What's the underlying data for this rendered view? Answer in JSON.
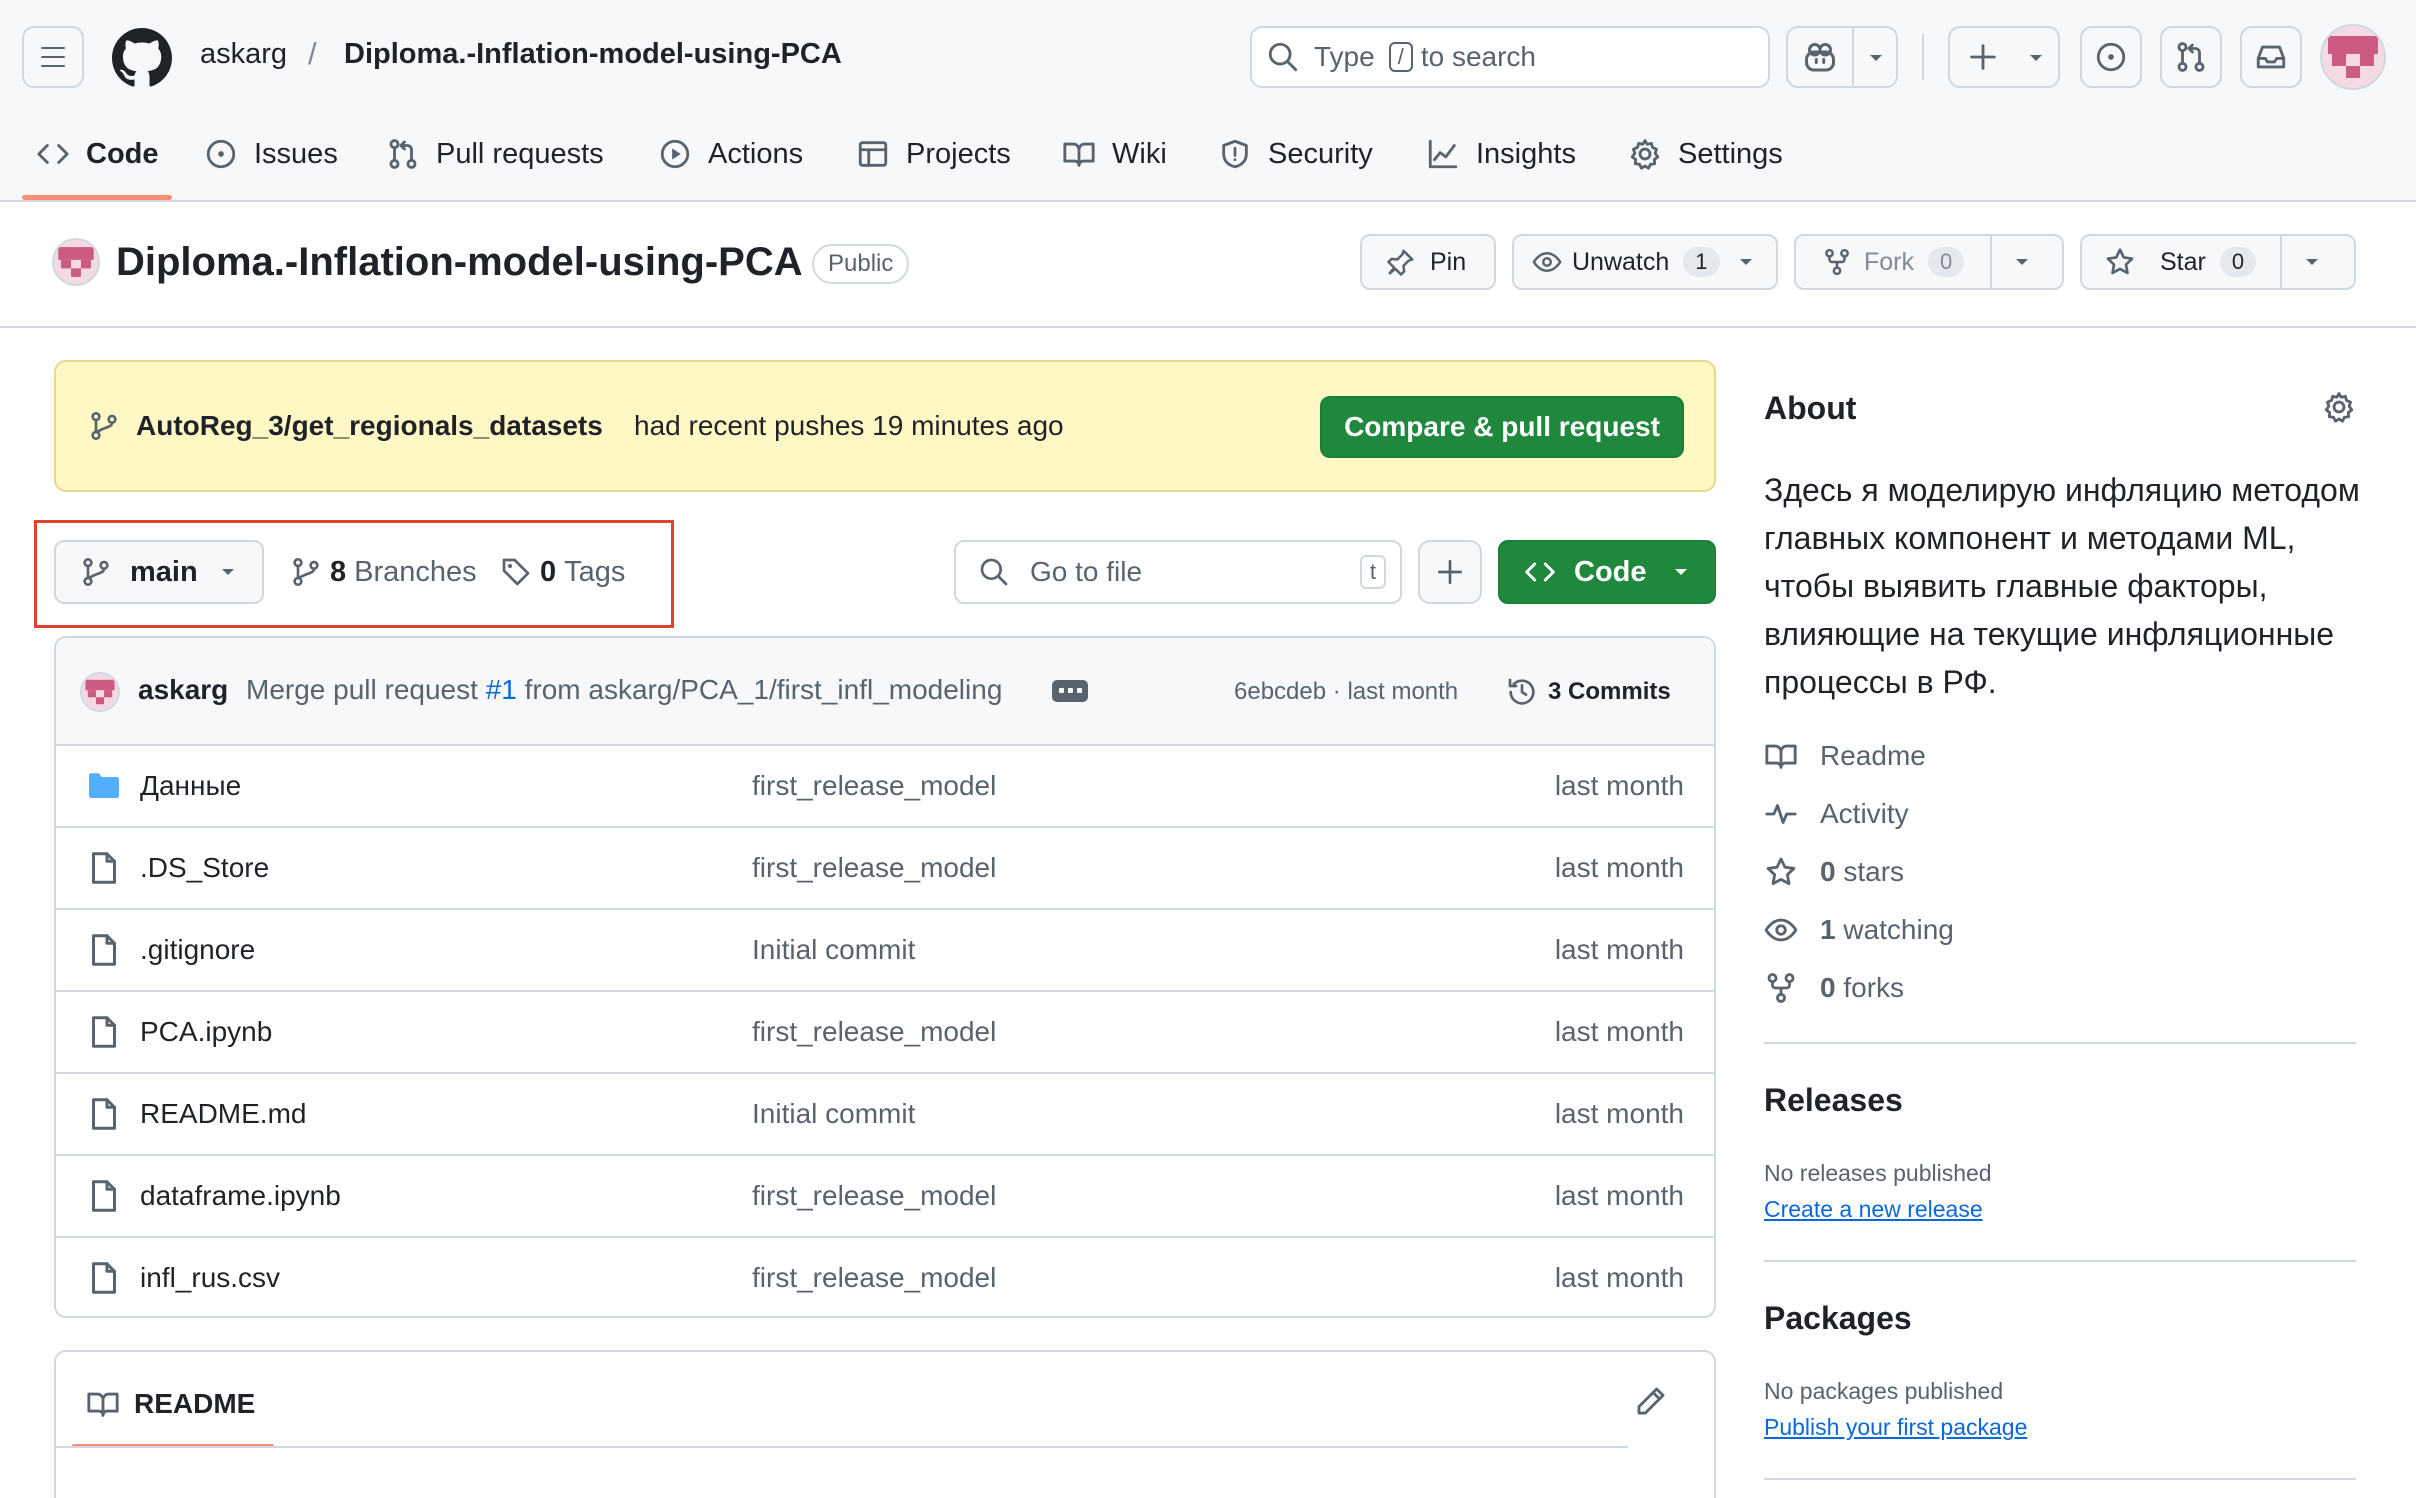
{
  "header": {
    "owner": "askarg",
    "separator": "/",
    "repo": "Diploma.-Inflation-model-using-PCA",
    "search_prefix": "Type",
    "search_key": "/",
    "search_suffix": "to search"
  },
  "nav": {
    "tabs": [
      {
        "label": "Code",
        "icon": "code-icon"
      },
      {
        "label": "Issues",
        "icon": "issue-icon"
      },
      {
        "label": "Pull requests",
        "icon": "pull-request-icon"
      },
      {
        "label": "Actions",
        "icon": "play-icon"
      },
      {
        "label": "Projects",
        "icon": "table-icon"
      },
      {
        "label": "Wiki",
        "icon": "book-icon"
      },
      {
        "label": "Security",
        "icon": "shield-icon"
      },
      {
        "label": "Insights",
        "icon": "graph-icon"
      },
      {
        "label": "Settings",
        "icon": "gear-icon"
      }
    ]
  },
  "repo_header": {
    "name": "Diploma.-Inflation-model-using-PCA",
    "visibility": "Public",
    "pin_label": "Pin",
    "unwatch_label": "Unwatch",
    "watch_count": "1",
    "fork_label": "Fork",
    "fork_count": "0",
    "star_label": "Star",
    "star_count": "0"
  },
  "banner": {
    "branch": "AutoReg_3/get_regionals_datasets",
    "text": "had recent pushes 19 minutes ago",
    "button": "Compare & pull request"
  },
  "branch_bar": {
    "branch": "main",
    "branches_count": "8",
    "branches_label": "Branches",
    "tags_count": "0",
    "tags_label": "Tags",
    "goto_placeholder": "Go to file",
    "goto_key": "t",
    "code_button": "Code"
  },
  "commit": {
    "author": "askarg",
    "message_prefix": "Merge pull request",
    "pr": "#1",
    "message_suffix": "from askarg/PCA_1/first_infl_modeling",
    "sha": "6ebcdeb",
    "dot": "·",
    "time": "last month",
    "commits": "3 Commits"
  },
  "files": [
    {
      "name": "Данные",
      "type": "folder",
      "message": "first_release_model",
      "time": "last month"
    },
    {
      "name": ".DS_Store",
      "type": "file",
      "message": "first_release_model",
      "time": "last month"
    },
    {
      "name": ".gitignore",
      "type": "file",
      "message": "Initial commit",
      "time": "last month"
    },
    {
      "name": "PCA.ipynb",
      "type": "file",
      "message": "first_release_model",
      "time": "last month"
    },
    {
      "name": "README.md",
      "type": "file",
      "message": "Initial commit",
      "time": "last month"
    },
    {
      "name": "dataframe.ipynb",
      "type": "file",
      "message": "first_release_model",
      "time": "last month"
    },
    {
      "name": "infl_rus.csv",
      "type": "file",
      "message": "first_release_model",
      "time": "last month"
    }
  ],
  "readme": {
    "title": "README"
  },
  "about": {
    "title": "About",
    "description": "Здесь я моделирую инфляцию методом главных компонент и методами ML, чтобы выявить главные факторы, влияющие на текущие инфляционные процессы в РФ.",
    "readme_label": "Readme",
    "activity_label": "Activity",
    "stars_count": "0",
    "stars_label": "stars",
    "watching_count": "1",
    "watching_label": "watching",
    "forks_count": "0",
    "forks_label": "forks"
  },
  "releases": {
    "title": "Releases",
    "empty": "No releases published",
    "link": "Create a new release"
  },
  "packages": {
    "title": "Packages",
    "empty": "No packages published",
    "link": "Publish your first package"
  },
  "colors": {
    "accent_green": "#1f883d",
    "highlight_red": "#e0432f",
    "link_blue": "#0969da",
    "nav_underline": "#fd8c73",
    "banner_bg": "#fff8c5"
  }
}
